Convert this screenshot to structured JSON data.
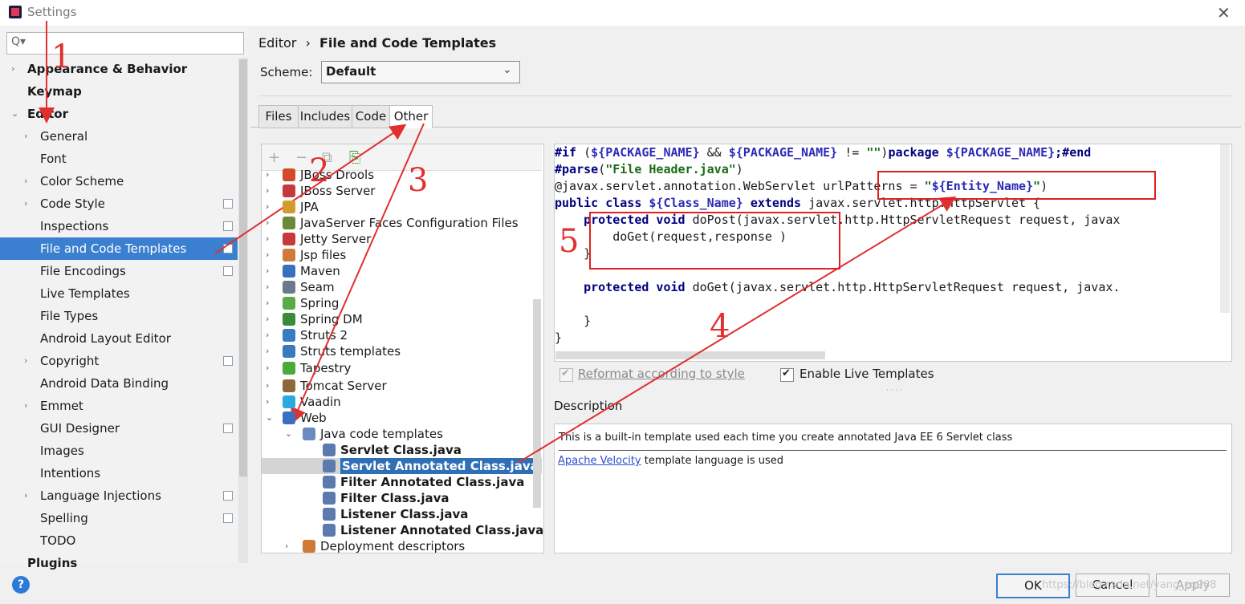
{
  "window": {
    "title": "Settings"
  },
  "sidebar": {
    "search_placeholder": "Q▾",
    "items": [
      {
        "label": "Appearance & Behavior",
        "bold": true,
        "arrow": "›",
        "indent": 0
      },
      {
        "label": "Keymap",
        "bold": true,
        "arrow": "",
        "indent": 0
      },
      {
        "label": "Editor",
        "bold": true,
        "arrow": "⌄",
        "indent": 0
      },
      {
        "label": "General",
        "arrow": "›",
        "indent": 1
      },
      {
        "label": "Font",
        "arrow": "",
        "indent": 1
      },
      {
        "label": "Color Scheme",
        "arrow": "›",
        "indent": 1
      },
      {
        "label": "Code Style",
        "arrow": "›",
        "indent": 1,
        "sync": true
      },
      {
        "label": "Inspections",
        "arrow": "",
        "indent": 1,
        "sync": true
      },
      {
        "label": "File and Code Templates",
        "arrow": "",
        "indent": 1,
        "sync": true,
        "selected": true
      },
      {
        "label": "File Encodings",
        "arrow": "",
        "indent": 1,
        "sync": true
      },
      {
        "label": "Live Templates",
        "arrow": "",
        "indent": 1
      },
      {
        "label": "File Types",
        "arrow": "",
        "indent": 1
      },
      {
        "label": "Android Layout Editor",
        "arrow": "",
        "indent": 1
      },
      {
        "label": "Copyright",
        "arrow": "›",
        "indent": 1,
        "sync": true
      },
      {
        "label": "Android Data Binding",
        "arrow": "",
        "indent": 1
      },
      {
        "label": "Emmet",
        "arrow": "›",
        "indent": 1
      },
      {
        "label": "GUI Designer",
        "arrow": "",
        "indent": 1,
        "sync": true
      },
      {
        "label": "Images",
        "arrow": "",
        "indent": 1
      },
      {
        "label": "Intentions",
        "arrow": "",
        "indent": 1
      },
      {
        "label": "Language Injections",
        "arrow": "›",
        "indent": 1,
        "sync": true
      },
      {
        "label": "Spelling",
        "arrow": "",
        "indent": 1,
        "sync": true
      },
      {
        "label": "TODO",
        "arrow": "",
        "indent": 1
      },
      {
        "label": "Plugins",
        "bold": true,
        "arrow": "",
        "indent": 0
      }
    ]
  },
  "header": {
    "breadcrumb_parent": "Editor",
    "breadcrumb_sep": "›",
    "breadcrumb_current": "File and Code Templates",
    "scheme_label": "Scheme:",
    "scheme_value": "Default"
  },
  "tabs": [
    "Files",
    "Includes",
    "Code",
    "Other"
  ],
  "active_tab": "Other",
  "tree": {
    "toolbar": [
      "+",
      "−",
      "⧉",
      "⎘"
    ],
    "rows": [
      {
        "label": "JBoss Drools",
        "arrow": "›",
        "icon": "#d24a2a",
        "level": 0
      },
      {
        "label": "JBoss Server",
        "arrow": "›",
        "icon": "#c43a3a",
        "level": 0
      },
      {
        "label": "JPA",
        "arrow": "›",
        "icon": "#d49a2a",
        "level": 0
      },
      {
        "label": "JavaServer Faces Configuration Files",
        "arrow": "›",
        "icon": "#6a8a3a",
        "level": 0
      },
      {
        "label": "Jetty Server",
        "arrow": "›",
        "icon": "#c43a3a",
        "level": 0
      },
      {
        "label": "Jsp files",
        "arrow": "›",
        "icon": "#d07a3a",
        "level": 0
      },
      {
        "label": "Maven",
        "arrow": "›",
        "icon": "#3a6fc0",
        "level": 0
      },
      {
        "label": "Seam",
        "arrow": "›",
        "icon": "#6a7a8a",
        "level": 0
      },
      {
        "label": "Spring",
        "arrow": "›",
        "icon": "#5aaa4a",
        "level": 0
      },
      {
        "label": "Spring DM",
        "arrow": "›",
        "icon": "#3a8a3a",
        "level": 0
      },
      {
        "label": "Struts 2",
        "arrow": "›",
        "icon": "#3a7ac0",
        "level": 0
      },
      {
        "label": "Struts templates",
        "arrow": "›",
        "icon": "#3a7ac0",
        "level": 0
      },
      {
        "label": "Tapestry",
        "arrow": "›",
        "icon": "#4aaa3a",
        "level": 0
      },
      {
        "label": "Tomcat Server",
        "arrow": "›",
        "icon": "#8a6a3a",
        "level": 0
      },
      {
        "label": "Vaadin",
        "arrow": "›",
        "icon": "#2aaadd",
        "level": 0
      },
      {
        "label": "Web",
        "arrow": "⌄",
        "icon": "#3a6fc0",
        "level": 0
      },
      {
        "label": "Java code templates",
        "arrow": "⌄",
        "icon": "#6a8ac0",
        "level": 1
      },
      {
        "label": "Servlet Class.java",
        "arrow": "",
        "icon": "#5a7ab0",
        "level": 2,
        "bold": true
      },
      {
        "label": "Servlet Annotated Class.java",
        "arrow": "",
        "icon": "#5a7ab0",
        "level": 2,
        "bold": true,
        "selected": true
      },
      {
        "label": "Filter Annotated Class.java",
        "arrow": "",
        "icon": "#5a7ab0",
        "level": 2,
        "bold": true
      },
      {
        "label": "Filter Class.java",
        "arrow": "",
        "icon": "#5a7ab0",
        "level": 2,
        "bold": true
      },
      {
        "label": "Listener Class.java",
        "arrow": "",
        "icon": "#5a7ab0",
        "level": 2,
        "bold": true
      },
      {
        "label": "Listener Annotated Class.java",
        "arrow": "",
        "icon": "#5a7ab0",
        "level": 2,
        "bold": true
      },
      {
        "label": "Deployment descriptors",
        "arrow": "›",
        "icon": "#d07a3a",
        "level": 1
      }
    ]
  },
  "editor": {
    "lines": [
      [
        [
          "kw",
          "#if"
        ],
        [
          "p",
          " ("
        ],
        [
          "var",
          "${PACKAGE_NAME}"
        ],
        [
          "p",
          " && "
        ],
        [
          "var",
          "${PACKAGE_NAME}"
        ],
        [
          "p",
          " != "
        ],
        [
          "str",
          "\"\""
        ],
        [
          "p",
          ")"
        ],
        [
          "kw",
          "package "
        ],
        [
          "var",
          "${PACKAGE_NAME}"
        ],
        [
          "kw",
          ";#end"
        ]
      ],
      [
        [
          "kw",
          "#parse"
        ],
        [
          "p",
          "("
        ],
        [
          "str",
          "\"File Header.java\""
        ],
        [
          "p",
          ")"
        ]
      ],
      [
        [
          "p",
          "@javax.servlet.annotation.WebServlet urlPatterns = "
        ],
        [
          "str",
          "\""
        ],
        [
          "var",
          "${Entity_Name}"
        ],
        [
          "str",
          "\""
        ],
        [
          "p",
          ")"
        ]
      ],
      [
        [
          "kw",
          "public class "
        ],
        [
          "var",
          "${Class_Name}"
        ],
        [
          "kw",
          " extends "
        ],
        [
          "p",
          "javax.servlet.http.HttpServlet {"
        ]
      ],
      [
        [
          "p",
          "    "
        ],
        [
          "kw",
          "protected void "
        ],
        [
          "p",
          "doPost(javax.servlet.http.HttpServletRequest request, javax"
        ]
      ],
      [
        [
          "p",
          "        doGet(request,response )"
        ]
      ],
      [
        [
          "p",
          "    }"
        ]
      ],
      [
        [
          "p",
          ""
        ]
      ],
      [
        [
          "p",
          "    "
        ],
        [
          "kw",
          "protected void "
        ],
        [
          "p",
          "doGet(javax.servlet.http.HttpServletRequest request, javax."
        ]
      ],
      [
        [
          "p",
          ""
        ]
      ],
      [
        [
          "p",
          "    }"
        ]
      ],
      [
        [
          "p",
          "}"
        ]
      ]
    ]
  },
  "options": {
    "reformat_label": "Reformat according to style",
    "reformat_checked": true,
    "live_templates_label": "Enable Live Templates",
    "live_templates_checked": true
  },
  "description": {
    "title": "Description",
    "text": "This is a built-in template used each time you create annotated Java EE 6 Servlet class",
    "link": "Apache Velocity",
    "link_suffix": " template language is used"
  },
  "buttons": {
    "ok": "OK",
    "cancel": "Cancel",
    "apply": "Apply",
    "help": "?"
  },
  "watermark": "https://blog.csdn.net/yang_zg968",
  "annotations": [
    "1",
    "2",
    "3",
    "4",
    "5"
  ],
  "colors": {
    "selection": "#3a7fd0",
    "annotation": "#e03030",
    "keyword": "#000080",
    "variable": "#2b2bb8",
    "string": "#1a6a1a"
  }
}
